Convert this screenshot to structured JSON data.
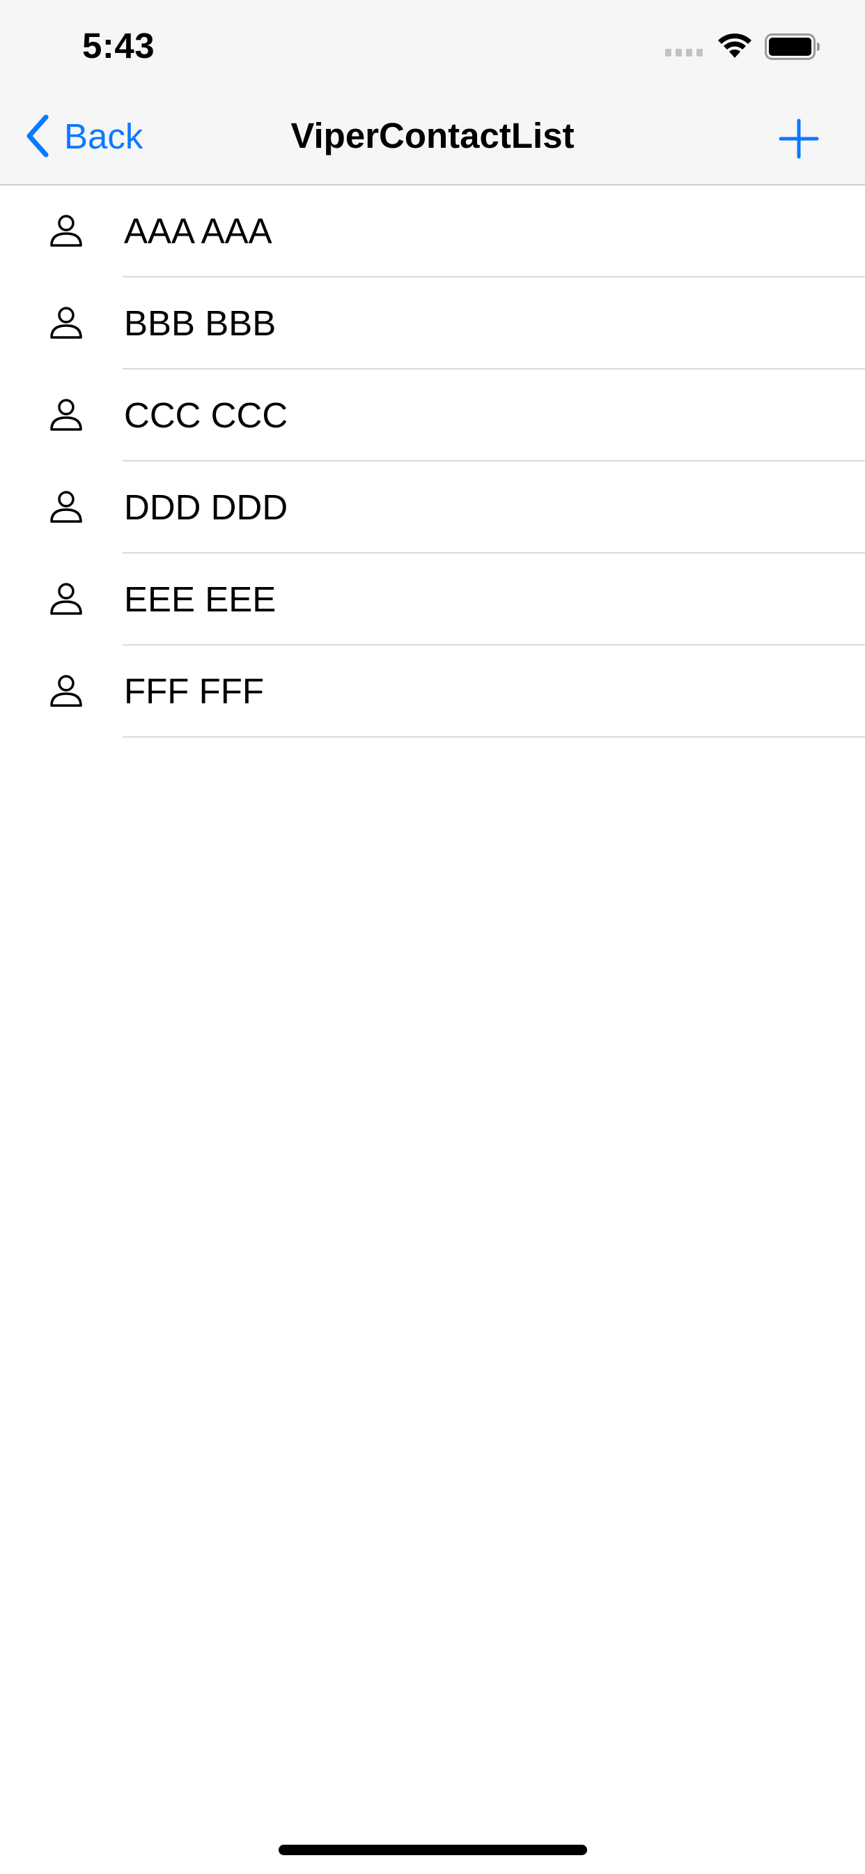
{
  "status_bar": {
    "time": "5:43"
  },
  "nav_bar": {
    "back_label": "Back",
    "title": "ViperContactList",
    "add_icon": "plus-icon"
  },
  "contacts": [
    {
      "name": "AAA AAA",
      "icon": "person-icon"
    },
    {
      "name": "BBB BBB",
      "icon": "person-icon"
    },
    {
      "name": "CCC CCC",
      "icon": "person-icon"
    },
    {
      "name": "DDD DDD",
      "icon": "person-icon"
    },
    {
      "name": "EEE EEE",
      "icon": "person-icon"
    },
    {
      "name": "FFF FFF",
      "icon": "person-icon"
    }
  ],
  "colors": {
    "accent": "#0a7aff",
    "nav_background": "#f6f6f6",
    "separator": "#dcdcde"
  }
}
